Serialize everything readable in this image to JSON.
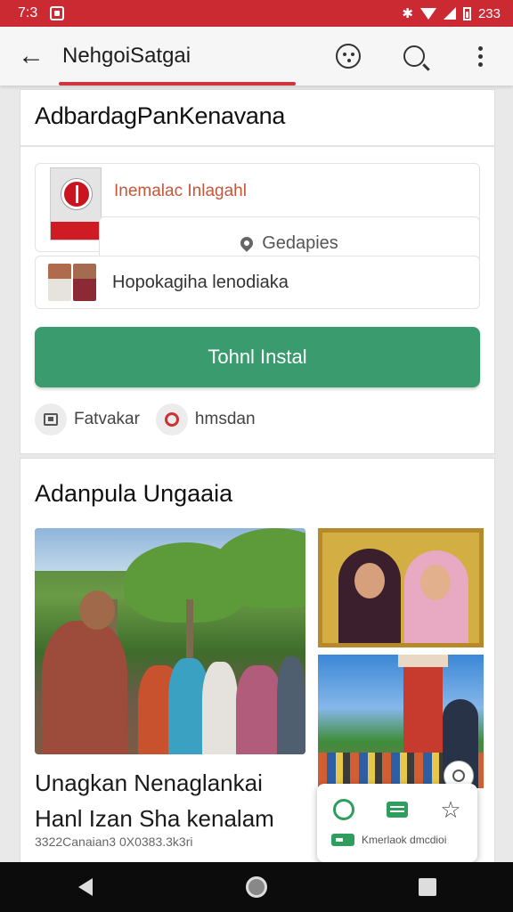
{
  "status_bar": {
    "time": "7:3",
    "right_text": "233"
  },
  "app_bar": {
    "title": "NehgoiSatgai"
  },
  "card1": {
    "heading": "AdbardagPanKenavana",
    "org_name": "Inemalac Inlagahl",
    "location": "Gedapies",
    "people_label": "Hopokagiha lenodiaka",
    "install_button": "Tohnl Instal",
    "chips": [
      {
        "label": "Fatvakar",
        "icon": "calendar-icon"
      },
      {
        "label": "hmsdan",
        "icon": "ring-icon"
      }
    ]
  },
  "card2": {
    "heading": "Adanpula Ungaaia",
    "article_title_line1": "Unagkan Nenaglankai",
    "article_title_line2": "Hanl Izan Sha kenalam",
    "article_meta": "3322Canaian3 0X0383.3k3ri"
  },
  "share_popup": {
    "footer_text": "Kmerlaok dmcdioi"
  },
  "colors": {
    "accent_red": "#cc2a33",
    "install_green": "#3a9b6f",
    "org_name": "#c5563a"
  }
}
